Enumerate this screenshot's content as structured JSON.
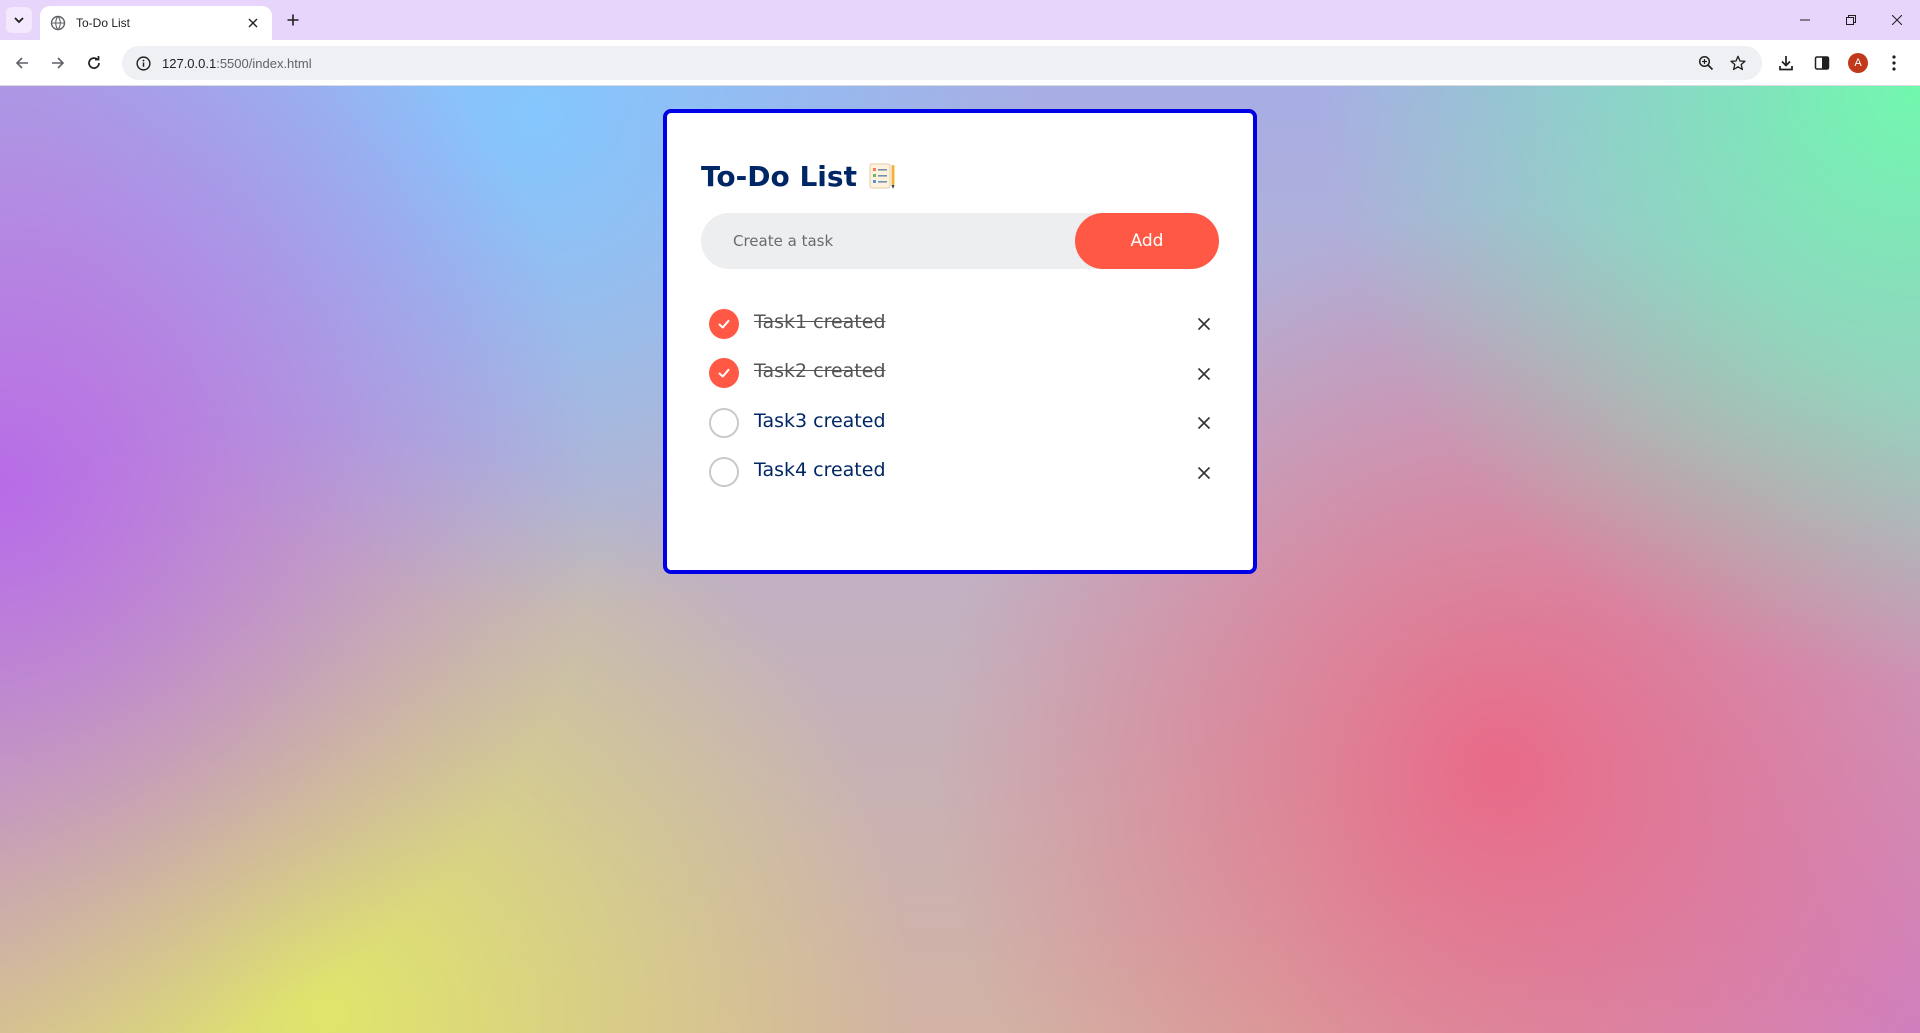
{
  "browser": {
    "tab_title": "To-Do List",
    "url_host": "127.0.0.1",
    "url_rest": ":5500/index.html",
    "profile_initial": "A"
  },
  "app": {
    "title": "To-Do List",
    "input_placeholder": "Create a task",
    "input_value": "",
    "add_label": "Add",
    "accent_color": "#ff5945",
    "title_color": "#002765",
    "card_border_color": "#0000e6"
  },
  "tasks": [
    {
      "label": "Task1 created",
      "checked": true
    },
    {
      "label": "Task2 created",
      "checked": true
    },
    {
      "label": "Task3 created",
      "checked": false
    },
    {
      "label": "Task4 created",
      "checked": false
    }
  ]
}
